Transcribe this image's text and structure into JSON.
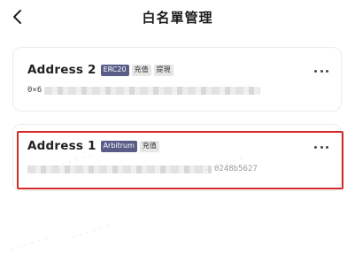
{
  "header": {
    "title": "白名單管理",
    "back_icon": "chevron-left-icon"
  },
  "addresses": [
    {
      "name": "Address 2",
      "network": "ERC20",
      "tags": [
        "充值",
        "提現"
      ],
      "address_prefix": "0×6",
      "address_suffix": ""
    },
    {
      "name": "Address 1",
      "network": "Arbitrum",
      "tags": [
        "充值"
      ],
      "address_prefix": "",
      "address_suffix": "0248b5627"
    }
  ],
  "more_icon": "more-horizontal-icon",
  "colors": {
    "network_badge": "#5a5d88",
    "tag_badge": "#e6e6e6",
    "highlight_border": "#d42a2a"
  }
}
